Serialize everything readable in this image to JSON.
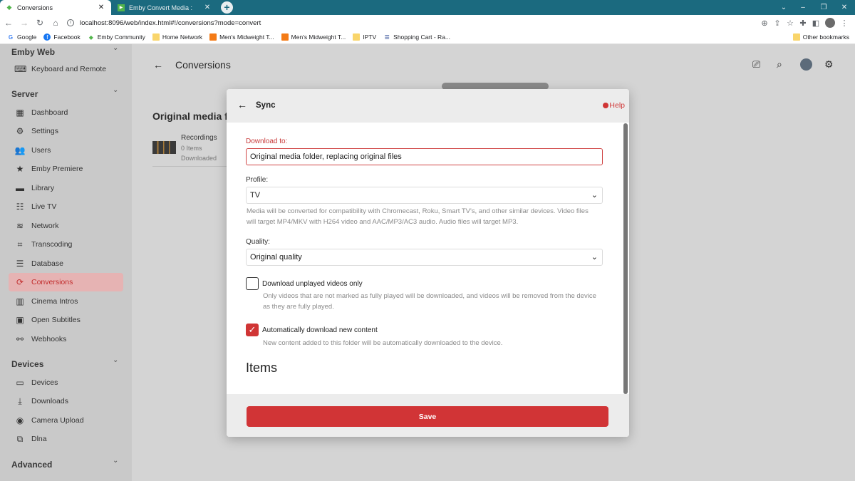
{
  "browser": {
    "tabs": [
      {
        "title": "Conversions",
        "active": true
      },
      {
        "title": "Emby Convert Media :",
        "active": false
      }
    ],
    "new_tab": "+",
    "url": "localhost:8096/web/index.html#!/conversions?mode=convert",
    "bookmarks": [
      "Google",
      "Facebook",
      "Emby Community",
      "Home Network",
      "Men's Midweight T...",
      "Men's Midweight T...",
      "IPTV",
      "Shopping Cart - Ra..."
    ],
    "other_bookmarks": "Other bookmarks"
  },
  "sidebar": {
    "top_section": "Emby Web",
    "top_items": [
      {
        "label": "Keyboard and Remote",
        "icon": "keyboard-icon"
      }
    ],
    "server_section": "Server",
    "server_items": [
      {
        "label": "Dashboard",
        "icon": "dashboard-icon"
      },
      {
        "label": "Settings",
        "icon": "gear-icon"
      },
      {
        "label": "Users",
        "icon": "users-icon"
      },
      {
        "label": "Emby Premiere",
        "icon": "star-icon"
      },
      {
        "label": "Library",
        "icon": "folder-icon"
      },
      {
        "label": "Live TV",
        "icon": "tv-guide-icon"
      },
      {
        "label": "Network",
        "icon": "wifi-icon"
      },
      {
        "label": "Transcoding",
        "icon": "crop-icon"
      },
      {
        "label": "Database",
        "icon": "database-icon"
      },
      {
        "label": "Conversions",
        "icon": "sync-icon",
        "active": true
      },
      {
        "label": "Cinema Intros",
        "icon": "film-icon"
      },
      {
        "label": "Open Subtitles",
        "icon": "subtitles-icon"
      },
      {
        "label": "Webhooks",
        "icon": "webhooks-icon"
      }
    ],
    "devices_section": "Devices",
    "devices_items": [
      {
        "label": "Devices",
        "icon": "devices-icon"
      },
      {
        "label": "Downloads",
        "icon": "download-icon"
      },
      {
        "label": "Camera Upload",
        "icon": "camera-icon"
      },
      {
        "label": "Dlna",
        "icon": "dlna-icon"
      }
    ],
    "advanced_section": "Advanced"
  },
  "main": {
    "title": "Conversions",
    "content_heading": "Original media f",
    "recording": {
      "title": "Recordings",
      "count": "0 Items",
      "status": "Downloaded"
    }
  },
  "dialog": {
    "title": "Sync",
    "help": "Help",
    "download_to_label": "Download to:",
    "download_to_value": "Original media folder, replacing original files",
    "profile_label": "Profile:",
    "profile_value": "TV",
    "profile_help": "Media will be converted for compatibility with Chromecast, Roku, Smart TV's, and other similar devices. Video files will target MP4/MKV with H264 video and AAC/MP3/AC3 audio. Audio files will target MP3.",
    "quality_label": "Quality:",
    "quality_value": "Original quality",
    "unplayed_label": "Download unplayed videos only",
    "unplayed_checked": false,
    "unplayed_help": "Only videos that are not marked as fully played will be downloaded, and videos will be removed from the device as they are fully played.",
    "auto_label": "Automatically download new content",
    "auto_checked": true,
    "auto_help": "New content added to this folder will be automatically downloaded to the device.",
    "items_heading": "Items",
    "save_label": "Save"
  },
  "colors": {
    "accent": "#d13436",
    "tabbar": "#1b6a7f"
  }
}
